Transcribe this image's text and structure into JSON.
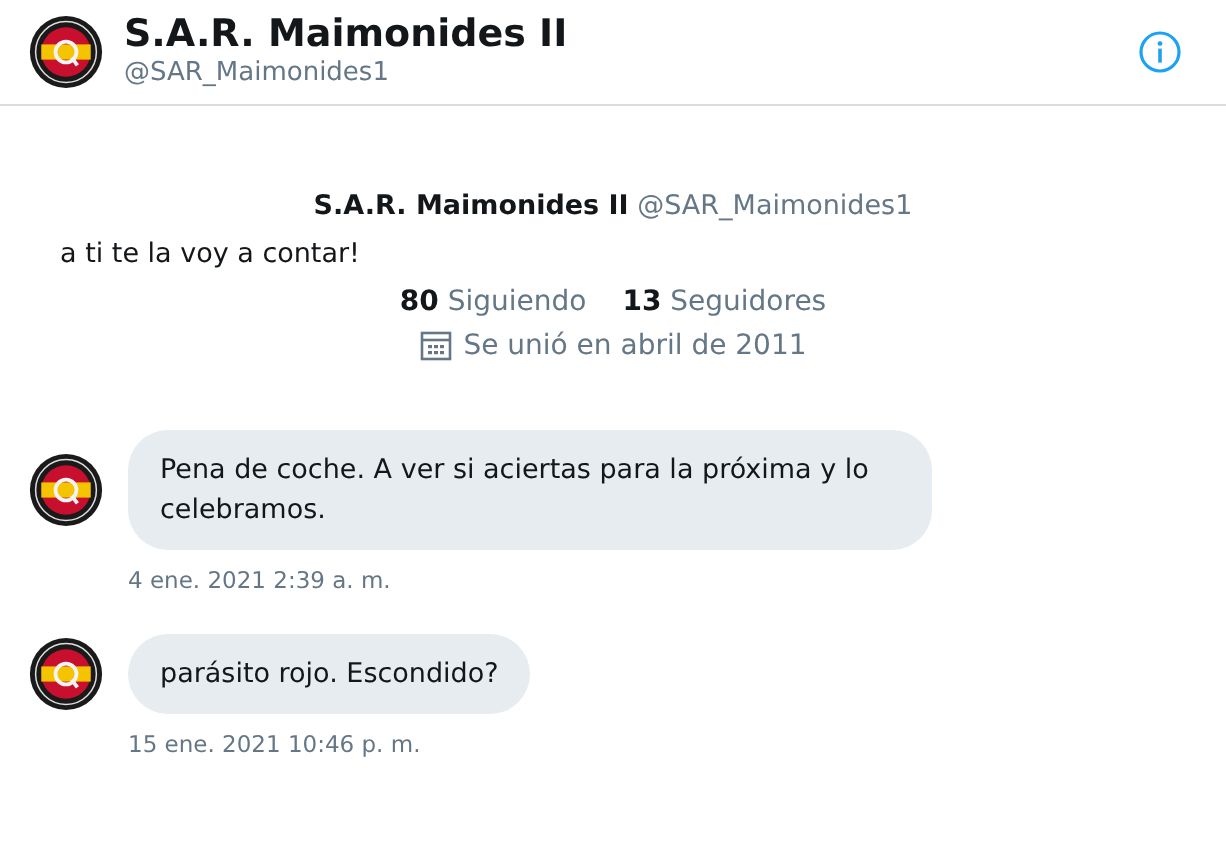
{
  "header": {
    "name": "S.A.R. Maimonides II",
    "handle": "@SAR_Maimonides1"
  },
  "profile": {
    "name": "S.A.R. Maimonides II",
    "handle": "@SAR_Maimonides1",
    "bio": "a ti te la voy a contar!",
    "following_count": "80",
    "following_label": "Siguiendo",
    "followers_count": "13",
    "followers_label": "Seguidores",
    "joined": "Se unió en abril de 2011"
  },
  "messages": [
    {
      "text": "Pena de coche. A ver si aciertas para la próxima y lo celebramos.",
      "time": "4 ene. 2021 2:39 a. m."
    },
    {
      "text": "parásito rojo. Escondido?",
      "time": "15 ene. 2021 10:46 p. m."
    }
  ]
}
